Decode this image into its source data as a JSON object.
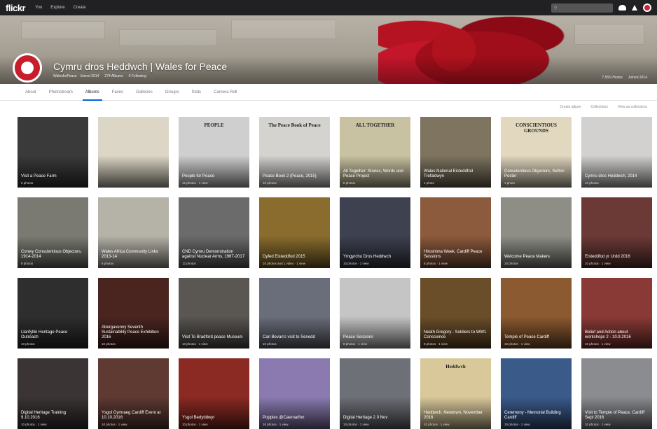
{
  "topbar": {
    "logo": "flickr",
    "nav": [
      "You",
      "Explore",
      "Create"
    ],
    "search_placeholder": "",
    "icons": [
      "upload-cloud-icon",
      "notifications-icon",
      "user-avatar-icon"
    ]
  },
  "group": {
    "title": "Cymru dros Heddwch | Wales for Peace",
    "meta": [
      "WalesforPeace · Joined 2014",
      "274 Albums",
      "0 Following"
    ],
    "stats": [
      "7,555 Photos",
      "Joined 2014"
    ]
  },
  "subnav": {
    "tabs": [
      "About",
      "Photostream",
      "Albums",
      "Faves",
      "Galleries",
      "Groups",
      "Stats",
      "Camera Roll"
    ],
    "active_index": 2
  },
  "actions": [
    "Create album",
    "Collections",
    "View as collections"
  ],
  "albums": [
    {
      "title": "Visit a Peace Farm",
      "count": "6 photos",
      "bg": "#3a3a3a",
      "thumb": ""
    },
    {
      "title": "",
      "count": "",
      "bg": "#dcd6c6",
      "thumb": ""
    },
    {
      "title": "People for Peace",
      "count": "12 photos · 1 view",
      "bg": "#cfcfcf",
      "thumb": "PEOPLE"
    },
    {
      "title": "Peace Book 2 (Peace, 2015)",
      "count": "10 photos",
      "bg": "#d5d3d0",
      "thumb": "The Peace Book of Peace"
    },
    {
      "title": "All Together: Stories, Words and Peace Project",
      "count": "8 photos",
      "bg": "#c9c2a2",
      "thumb": "ALL TOGETHER"
    },
    {
      "title": "Wales National Eisteddfod Trefaldwyn",
      "count": "1 photo",
      "bg": "#7e7460",
      "thumb": ""
    },
    {
      "title": "Conscientious Objectors, Sefton Poster",
      "count": "1 photo",
      "bg": "#e2d8c0",
      "thumb": "CONSCIENTIOUS GROUNDS"
    },
    {
      "title": "Cymru dros Heddwch, 2014",
      "count": "10 photos",
      "bg": "#d2d1cf",
      "thumb": ""
    },
    {
      "title": "Conwy Conscientious Objectors, 1914-2014",
      "count": "8 photos",
      "bg": "#7a7a72",
      "thumb": ""
    },
    {
      "title": "Wales Africa Community Links 2013-14",
      "count": "6 photos",
      "bg": "#b5b2a8",
      "thumb": ""
    },
    {
      "title": "CND Cymru Demonstration against Nuclear Arms, 1967-2017",
      "count": "12 photos",
      "bg": "#6b6b6b",
      "thumb": ""
    },
    {
      "title": "Dyfed Eisteddfod 2015",
      "count": "10 photos and 1 video · 1 view",
      "bg": "#8a6d2e",
      "thumb": ""
    },
    {
      "title": "Ymgyrchu Dros Heddwch",
      "count": "10 photos · 1 view",
      "bg": "#3e4150",
      "thumb": ""
    },
    {
      "title": "Hiroshima Week, Cardiff Peace Sessions",
      "count": "8 photos · 1 view",
      "bg": "#8c5a3c",
      "thumb": ""
    },
    {
      "title": "Welcome Peace Makers",
      "count": "10 photos",
      "bg": "#8e8e86",
      "thumb": ""
    },
    {
      "title": "Eisteddfod yr Urdd 2016",
      "count": "10 photos · 1 view",
      "bg": "#6b3a36",
      "thumb": ""
    },
    {
      "title": "Llanfyllin Heritage Peace Outreach",
      "count": "10 photos",
      "bg": "#2e2e2e",
      "thumb": ""
    },
    {
      "title": "Abergavenny Seventh Sustainability Peace Exhibition 2016",
      "count": "10 photos",
      "bg": "#4a2520",
      "thumb": ""
    },
    {
      "title": "Visit To Bradford peace Museum",
      "count": "10 photos · 1 view",
      "bg": "#5a5652",
      "thumb": ""
    },
    {
      "title": "Cari Bevan's visit to Senedd",
      "count": "10 photos",
      "bg": "#6a6e7a",
      "thumb": ""
    },
    {
      "title": "Peace Sessions",
      "count": "8 photos · 1 view",
      "bg": "#c5c5c5",
      "thumb": ""
    },
    {
      "title": "Neath Gregory - Soldiers to WW1 Conscience",
      "count": "8 photos · 1 view",
      "bg": "#6a4e2a",
      "thumb": ""
    },
    {
      "title": "Temple of Peace Cardiff",
      "count": "10 photos · 1 view",
      "bg": "#8c5a30",
      "thumb": ""
    },
    {
      "title": "Belief and Action about workshops 2 - 10.9.2016",
      "count": "10 photos · 1 view",
      "bg": "#8a3a36",
      "thumb": ""
    },
    {
      "title": "Digital Heritage Training 9.10.2016",
      "count": "10 photos · 1 view",
      "bg": "#3a3434",
      "thumb": ""
    },
    {
      "title": "Ysgol Gymraeg Cardiff Event at 10.10.2016",
      "count": "10 photos · 1 view",
      "bg": "#5e3a32",
      "thumb": ""
    },
    {
      "title": "Ysgol Bedyddwyr",
      "count": "10 photos · 1 view",
      "bg": "#8a2a22",
      "thumb": ""
    },
    {
      "title": "Poppies @Caernarfon",
      "count": "10 photos · 1 view",
      "bg": "#8a7ab0",
      "thumb": ""
    },
    {
      "title": "Digital Heritage 2.0 Nov",
      "count": "10 photos · 1 view",
      "bg": "#6e7078",
      "thumb": ""
    },
    {
      "title": "Heddwch, Newtown, November 2016",
      "count": "10 photos · 1 view",
      "bg": "#d8c89a",
      "thumb": "Heddwch"
    },
    {
      "title": "Ceremony - Memorial Building Cardiff",
      "count": "10 photos · 1 view",
      "bg": "#3a5a8a",
      "thumb": ""
    },
    {
      "title": "Visit to Temple of Peace, Cardiff Sept 2016",
      "count": "10 photos · 1 view",
      "bg": "#8a8c90",
      "thumb": ""
    }
  ]
}
